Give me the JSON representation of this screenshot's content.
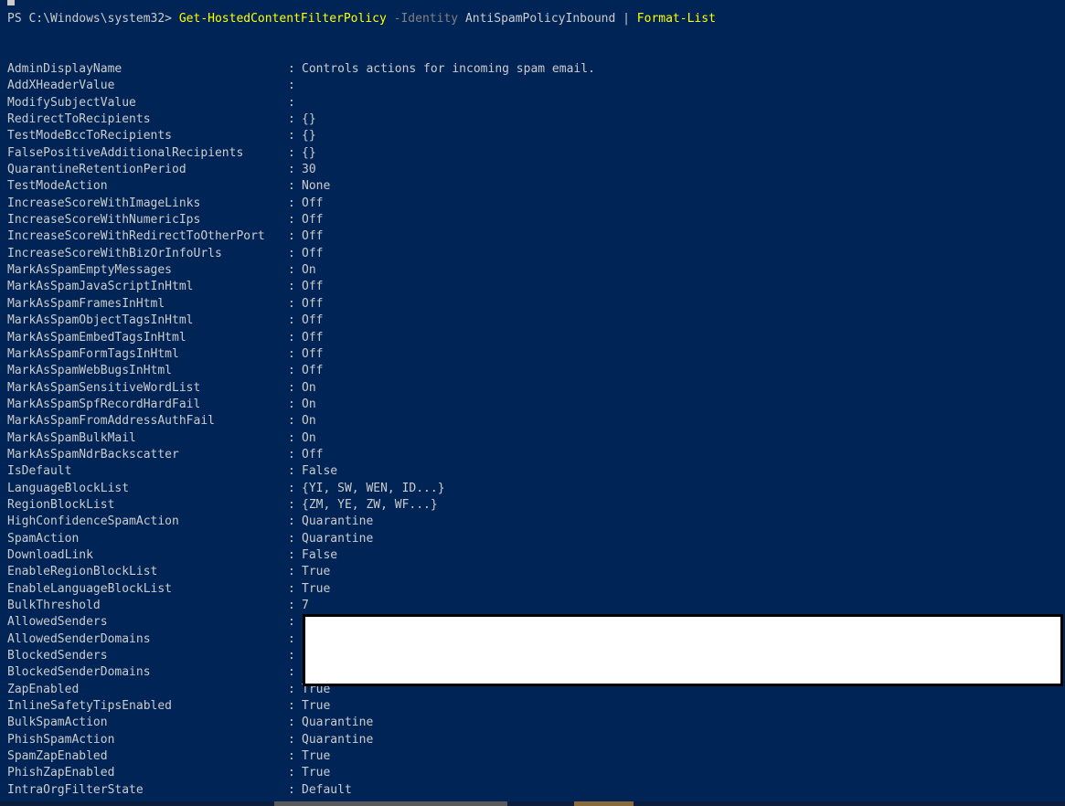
{
  "prompt": {
    "path": "PS C:\\Windows\\system32> ",
    "cmdlet": "Get-HostedContentFilterPolicy",
    "param": "-Identity",
    "arg": "AntiSpamPolicyInbound",
    "pipe": "|",
    "format": "Format-List"
  },
  "separator": ":",
  "properties": [
    {
      "key": "AdminDisplayName",
      "value": "Controls actions for incoming spam email."
    },
    {
      "key": "AddXHeaderValue",
      "value": ""
    },
    {
      "key": "ModifySubjectValue",
      "value": ""
    },
    {
      "key": "RedirectToRecipients",
      "value": "{}"
    },
    {
      "key": "TestModeBccToRecipients",
      "value": "{}"
    },
    {
      "key": "FalsePositiveAdditionalRecipients",
      "value": "{}"
    },
    {
      "key": "QuarantineRetentionPeriod",
      "value": "30"
    },
    {
      "key": "TestModeAction",
      "value": "None"
    },
    {
      "key": "IncreaseScoreWithImageLinks",
      "value": "Off"
    },
    {
      "key": "IncreaseScoreWithNumericIps",
      "value": "Off"
    },
    {
      "key": "IncreaseScoreWithRedirectToOtherPort",
      "value": "Off"
    },
    {
      "key": "IncreaseScoreWithBizOrInfoUrls",
      "value": "Off"
    },
    {
      "key": "MarkAsSpamEmptyMessages",
      "value": "On"
    },
    {
      "key": "MarkAsSpamJavaScriptInHtml",
      "value": "Off"
    },
    {
      "key": "MarkAsSpamFramesInHtml",
      "value": "Off"
    },
    {
      "key": "MarkAsSpamObjectTagsInHtml",
      "value": "Off"
    },
    {
      "key": "MarkAsSpamEmbedTagsInHtml",
      "value": "Off"
    },
    {
      "key": "MarkAsSpamFormTagsInHtml",
      "value": "Off"
    },
    {
      "key": "MarkAsSpamWebBugsInHtml",
      "value": "Off"
    },
    {
      "key": "MarkAsSpamSensitiveWordList",
      "value": "On"
    },
    {
      "key": "MarkAsSpamSpfRecordHardFail",
      "value": "On"
    },
    {
      "key": "MarkAsSpamFromAddressAuthFail",
      "value": "On"
    },
    {
      "key": "MarkAsSpamBulkMail",
      "value": "On"
    },
    {
      "key": "MarkAsSpamNdrBackscatter",
      "value": "Off"
    },
    {
      "key": "IsDefault",
      "value": "False"
    },
    {
      "key": "LanguageBlockList",
      "value": "{YI, SW, WEN, ID...}"
    },
    {
      "key": "RegionBlockList",
      "value": "{ZM, YE, ZW, WF...}"
    },
    {
      "key": "HighConfidenceSpamAction",
      "value": "Quarantine"
    },
    {
      "key": "SpamAction",
      "value": "Quarantine"
    },
    {
      "key": "DownloadLink",
      "value": "False"
    },
    {
      "key": "EnableRegionBlockList",
      "value": "True"
    },
    {
      "key": "EnableLanguageBlockList",
      "value": "True"
    },
    {
      "key": "BulkThreshold",
      "value": "7"
    },
    {
      "key": "AllowedSenders",
      "value": ""
    },
    {
      "key": "AllowedSenderDomains",
      "value": ""
    },
    {
      "key": "BlockedSenders",
      "value": ""
    },
    {
      "key": "BlockedSenderDomains",
      "value": ""
    },
    {
      "key": "ZapEnabled",
      "value": "True"
    },
    {
      "key": "InlineSafetyTipsEnabled",
      "value": "True"
    },
    {
      "key": "BulkSpamAction",
      "value": "Quarantine"
    },
    {
      "key": "PhishSpamAction",
      "value": "Quarantine"
    },
    {
      "key": "SpamZapEnabled",
      "value": "True"
    },
    {
      "key": "PhishZapEnabled",
      "value": "True"
    },
    {
      "key": "IntraOrgFilterState",
      "value": "Default"
    }
  ],
  "colors": {
    "background": "#012456",
    "text": "#cccccc",
    "cmdlet": "#ffff00",
    "parameter": "#808080",
    "redaction": "#ffffff"
  }
}
